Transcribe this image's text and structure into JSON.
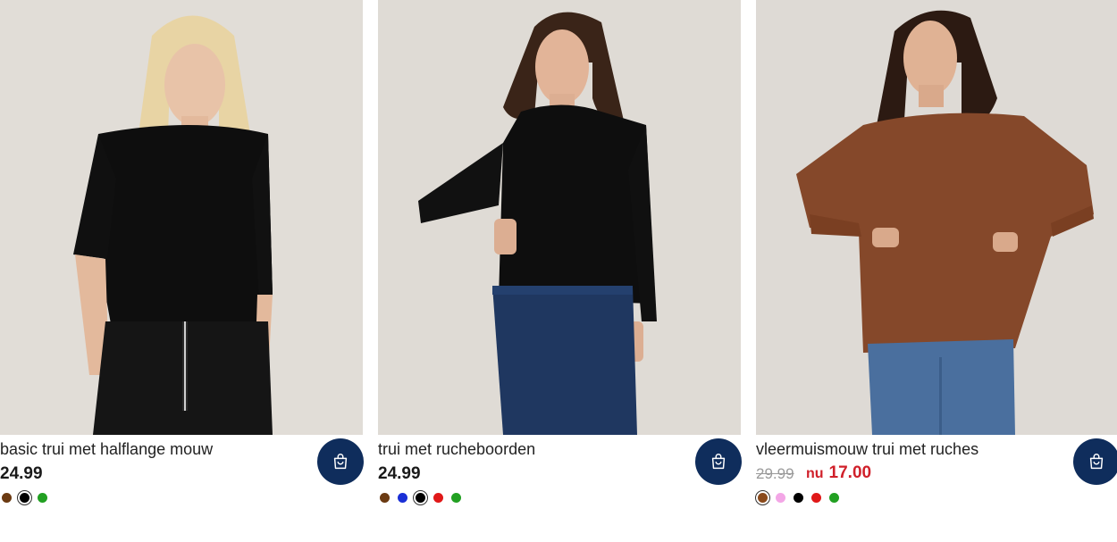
{
  "products": [
    {
      "title": "basic trui met halflange mouw",
      "price": "24.99",
      "image": "woman-black-short-sleeve-sweater",
      "swatches": [
        {
          "color": "#6b3a12",
          "selected": false
        },
        {
          "color": "#000000",
          "selected": true
        },
        {
          "color": "#22a022",
          "selected": false
        }
      ]
    },
    {
      "title": "trui met rucheboorden",
      "price": "24.99",
      "image": "woman-black-ruffle-sweater-jeans",
      "swatches": [
        {
          "color": "#6b3a12",
          "selected": false
        },
        {
          "color": "#1a2fd6",
          "selected": false
        },
        {
          "color": "#000000",
          "selected": true
        },
        {
          "color": "#e01818",
          "selected": false
        },
        {
          "color": "#22a022",
          "selected": false
        }
      ]
    },
    {
      "title": "vleermuismouw trui met ruches",
      "price_old": "29.99",
      "price_prefix": "nu",
      "price_now": "17.00",
      "image": "woman-brown-batwing-sweater-jeans",
      "swatches": [
        {
          "color": "#8a4a1c",
          "selected": true
        },
        {
          "color": "#f3a6e6",
          "selected": false
        },
        {
          "color": "#000000",
          "selected": false
        },
        {
          "color": "#e01818",
          "selected": false
        },
        {
          "color": "#22a022",
          "selected": false
        }
      ]
    }
  ],
  "icons": {
    "cart": "shopping-bag-icon"
  },
  "colors": {
    "cart_button": "#0f2d5c",
    "sale_price": "#d0202a",
    "old_price": "#9a9a9a"
  }
}
